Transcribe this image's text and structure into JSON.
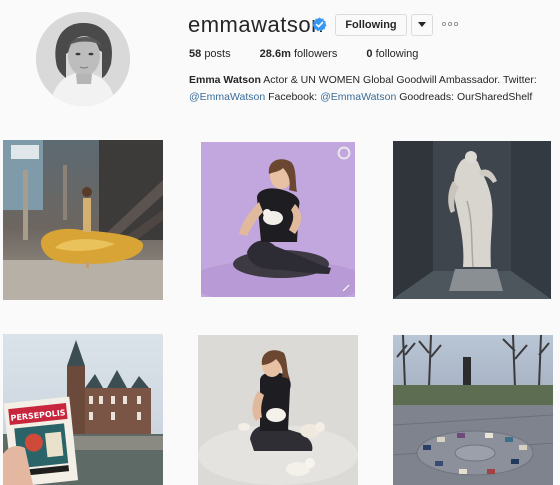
{
  "profile": {
    "username": "emmawatson",
    "follow_label": "Following",
    "stats": {
      "posts_count": "58",
      "posts_label": "posts",
      "followers_count": "28.6m",
      "followers_label": "followers",
      "following_count": "0",
      "following_label": "following"
    },
    "bio": {
      "name": "Emma Watson",
      "text1": " Actor & UN WOMEN Global Goodwill Ambassador. Twitter: ",
      "twitter": "@EmmaWatson",
      "text2": " Facebook: ",
      "facebook": "@EmmaWatson",
      "text3": " Goodreads: OurSharedShelf"
    }
  },
  "icons": {
    "verified": "verified-badge-icon",
    "dropdown": "chevron-down-icon",
    "more": "more-options-icon",
    "video": "video-icon",
    "album": "multiple-images-icon"
  },
  "colors": {
    "background": "#fafafa",
    "verified_blue": "#3897f0",
    "link_blue": "#3a6d99",
    "text": "#262626",
    "border": "#dbdbdb"
  },
  "posts": [
    {
      "subject": "woman in yellow ball gown on staircase"
    },
    {
      "subject": "woman sitting with kitten on lilac background",
      "overlay": "video"
    },
    {
      "subject": "white marble statue in dark gallery"
    },
    {
      "subject": "hand holding book Persepolis in front of castle",
      "book_title": "PERSEPOLIS"
    },
    {
      "subject": "woman sitting with kittens on grey background"
    },
    {
      "subject": "circle of books on paved plaza in park"
    }
  ]
}
